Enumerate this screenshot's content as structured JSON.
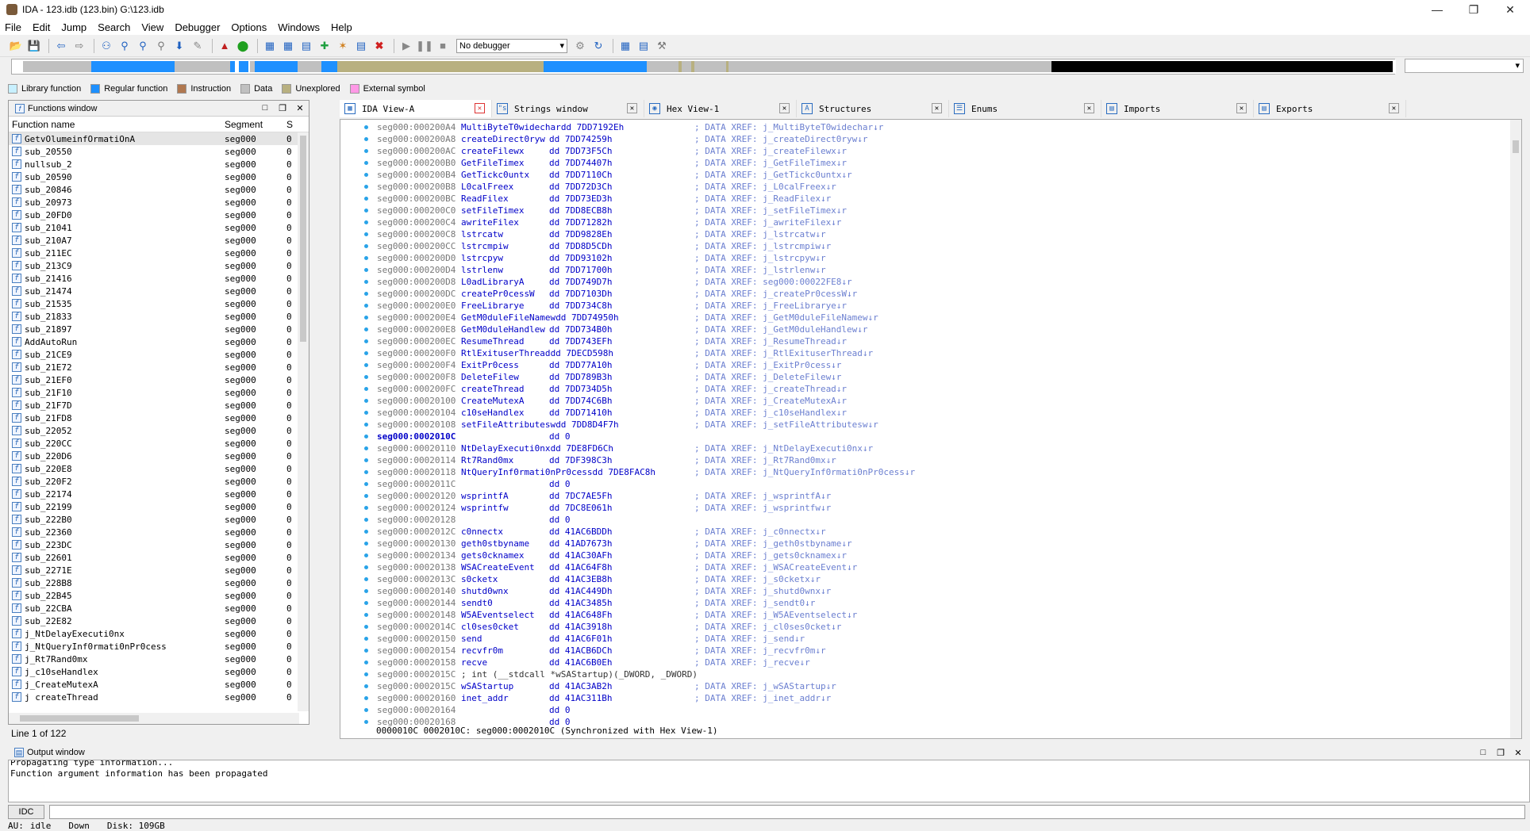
{
  "window": {
    "title": "IDA - 123.idb (123.bin) G:\\123.idb"
  },
  "menu": [
    "File",
    "Edit",
    "Jump",
    "Search",
    "View",
    "Debugger",
    "Options",
    "Windows",
    "Help"
  ],
  "toolbar": {
    "debugger_select": "No debugger"
  },
  "legend": [
    {
      "label": "Library function",
      "color": "#c8f0ff"
    },
    {
      "label": "Regular function",
      "color": "#1e90ff"
    },
    {
      "label": "Instruction",
      "color": "#b07850"
    },
    {
      "label": "Data",
      "color": "#c0c0c0"
    },
    {
      "label": "Unexplored",
      "color": "#b8b080"
    },
    {
      "label": "External symbol",
      "color": "#ff99e6"
    }
  ],
  "functions_window": {
    "title": "Functions window",
    "columns": [
      "Function name",
      "Segment",
      "S"
    ],
    "rows": [
      {
        "name": "GetvOlumeinfOrmatiOnA",
        "seg": "seg000",
        "s": "0"
      },
      {
        "name": "sub_20550",
        "seg": "seg000",
        "s": "0"
      },
      {
        "name": "nullsub_2",
        "seg": "seg000",
        "s": "0"
      },
      {
        "name": "sub_20590",
        "seg": "seg000",
        "s": "0"
      },
      {
        "name": "sub_20846",
        "seg": "seg000",
        "s": "0"
      },
      {
        "name": "sub_20973",
        "seg": "seg000",
        "s": "0"
      },
      {
        "name": "sub_20FD0",
        "seg": "seg000",
        "s": "0"
      },
      {
        "name": "sub_21041",
        "seg": "seg000",
        "s": "0"
      },
      {
        "name": "sub_210A7",
        "seg": "seg000",
        "s": "0"
      },
      {
        "name": "sub_211EC",
        "seg": "seg000",
        "s": "0"
      },
      {
        "name": "sub_213C9",
        "seg": "seg000",
        "s": "0"
      },
      {
        "name": "sub_21416",
        "seg": "seg000",
        "s": "0"
      },
      {
        "name": "sub_21474",
        "seg": "seg000",
        "s": "0"
      },
      {
        "name": "sub_21535",
        "seg": "seg000",
        "s": "0"
      },
      {
        "name": "sub_21833",
        "seg": "seg000",
        "s": "0"
      },
      {
        "name": "sub_21897",
        "seg": "seg000",
        "s": "0"
      },
      {
        "name": "AddAutoRun",
        "seg": "seg000",
        "s": "0"
      },
      {
        "name": "sub_21CE9",
        "seg": "seg000",
        "s": "0"
      },
      {
        "name": "sub_21E72",
        "seg": "seg000",
        "s": "0"
      },
      {
        "name": "sub_21EF0",
        "seg": "seg000",
        "s": "0"
      },
      {
        "name": "sub_21F10",
        "seg": "seg000",
        "s": "0"
      },
      {
        "name": "sub_21F7D",
        "seg": "seg000",
        "s": "0"
      },
      {
        "name": "sub_21FD8",
        "seg": "seg000",
        "s": "0"
      },
      {
        "name": "sub_22052",
        "seg": "seg000",
        "s": "0"
      },
      {
        "name": "sub_220CC",
        "seg": "seg000",
        "s": "0"
      },
      {
        "name": "sub_220D6",
        "seg": "seg000",
        "s": "0"
      },
      {
        "name": "sub_220E8",
        "seg": "seg000",
        "s": "0"
      },
      {
        "name": "sub_220F2",
        "seg": "seg000",
        "s": "0"
      },
      {
        "name": "sub_22174",
        "seg": "seg000",
        "s": "0"
      },
      {
        "name": "sub_22199",
        "seg": "seg000",
        "s": "0"
      },
      {
        "name": "sub_222B0",
        "seg": "seg000",
        "s": "0"
      },
      {
        "name": "sub_22360",
        "seg": "seg000",
        "s": "0"
      },
      {
        "name": "sub_223DC",
        "seg": "seg000",
        "s": "0"
      },
      {
        "name": "sub_22601",
        "seg": "seg000",
        "s": "0"
      },
      {
        "name": "sub_2271E",
        "seg": "seg000",
        "s": "0"
      },
      {
        "name": "sub_228B8",
        "seg": "seg000",
        "s": "0"
      },
      {
        "name": "sub_22B45",
        "seg": "seg000",
        "s": "0"
      },
      {
        "name": "sub_22CBA",
        "seg": "seg000",
        "s": "0"
      },
      {
        "name": "sub_22E82",
        "seg": "seg000",
        "s": "0"
      },
      {
        "name": "j_NtDelayExecuti0nx",
        "seg": "seg000",
        "s": "0"
      },
      {
        "name": "j_NtQueryInf0rmati0nPr0cess",
        "seg": "seg000",
        "s": "0"
      },
      {
        "name": "j_Rt7Rand0mx",
        "seg": "seg000",
        "s": "0"
      },
      {
        "name": "j_c10seHandlex",
        "seg": "seg000",
        "s": "0"
      },
      {
        "name": "j_CreateMutexA",
        "seg": "seg000",
        "s": "0"
      },
      {
        "name": "j_createThread",
        "seg": "seg000",
        "s": "0"
      }
    ],
    "status": "Line 1 of 122"
  },
  "tabs": [
    {
      "label": "IDA View-A",
      "icon": "graph-icon"
    },
    {
      "label": "Strings window",
      "icon": "strings-icon"
    },
    {
      "label": "Hex View-1",
      "icon": "hex-icon"
    },
    {
      "label": "Structures",
      "icon": "struct-icon"
    },
    {
      "label": "Enums",
      "icon": "enum-icon"
    },
    {
      "label": "Imports",
      "icon": "imports-icon"
    },
    {
      "label": "Exports",
      "icon": "exports-icon"
    }
  ],
  "ida_view": {
    "lines": [
      {
        "addr": "seg000:000200A4",
        "name": "MultiByteT0widechar",
        "op": "dd 7DD7192Eh",
        "cm": "; DATA XREF: j_MultiByteT0widechar↓r"
      },
      {
        "addr": "seg000:000200A8",
        "name": "createDirect0ryw",
        "op": "dd 7DD74259h",
        "cm": "; DATA XREF: j_createDirect0ryw↓r"
      },
      {
        "addr": "seg000:000200AC",
        "name": "createFilewx",
        "op": "dd 7DD73F5Ch",
        "cm": "; DATA XREF: j_createFilewx↓r"
      },
      {
        "addr": "seg000:000200B0",
        "name": "GetFileTimex",
        "op": "dd 7DD74407h",
        "cm": "; DATA XREF: j_GetFileTimex↓r"
      },
      {
        "addr": "seg000:000200B4",
        "name": "GetTickc0untx",
        "op": "dd 7DD7110Ch",
        "cm": "; DATA XREF: j_GetTickc0untx↓r"
      },
      {
        "addr": "seg000:000200B8",
        "name": "L0calFreex",
        "op": "dd 7DD72D3Ch",
        "cm": "; DATA XREF: j_L0calFreex↓r"
      },
      {
        "addr": "seg000:000200BC",
        "name": "ReadFilex",
        "op": "dd 7DD73ED3h",
        "cm": "; DATA XREF: j_ReadFilex↓r"
      },
      {
        "addr": "seg000:000200C0",
        "name": "setFileTimex",
        "op": "dd 7DD8ECB8h",
        "cm": "; DATA XREF: j_setFileTimex↓r"
      },
      {
        "addr": "seg000:000200C4",
        "name": "awriteFilex",
        "op": "dd 7DD71282h",
        "cm": "; DATA XREF: j_awriteFilex↓r"
      },
      {
        "addr": "seg000:000200C8",
        "name": "lstrcatw",
        "op": "dd 7DD9828Eh",
        "cm": "; DATA XREF: j_lstrcatw↓r"
      },
      {
        "addr": "seg000:000200CC",
        "name": "lstrcmpiw",
        "op": "dd 7DD8D5CDh",
        "cm": "; DATA XREF: j_lstrcmpiw↓r"
      },
      {
        "addr": "seg000:000200D0",
        "name": "lstrcpyw",
        "op": "dd 7DD93102h",
        "cm": "; DATA XREF: j_lstrcpyw↓r"
      },
      {
        "addr": "seg000:000200D4",
        "name": "lstrlenw",
        "op": "dd 7DD71700h",
        "cm": "; DATA XREF: j_lstrlenw↓r"
      },
      {
        "addr": "seg000:000200D8",
        "name": "L0adLibraryA",
        "op": "dd 7DD749D7h",
        "cm": "; DATA XREF: seg000:00022FE8↓r"
      },
      {
        "addr": "seg000:000200DC",
        "name": "createPr0cessW",
        "op": "dd 7DD7103Dh",
        "cm": "; DATA XREF: j_createPr0cessW↓r"
      },
      {
        "addr": "seg000:000200E0",
        "name": "FreeLibrarye",
        "op": "dd 7DD734C8h",
        "cm": "; DATA XREF: j_FreeLibrarye↓r"
      },
      {
        "addr": "seg000:000200E4",
        "name": "GetM0duleFileNamew",
        "op": "dd 7DD74950h",
        "cm": "; DATA XREF: j_GetM0duleFileNamew↓r"
      },
      {
        "addr": "seg000:000200E8",
        "name": "GetM0duleHandlew",
        "op": "dd 7DD734B0h",
        "cm": "; DATA XREF: j_GetM0duleHandlew↓r"
      },
      {
        "addr": "seg000:000200EC",
        "name": "ResumeThread",
        "op": "dd 7DD743EFh",
        "cm": "; DATA XREF: j_ResumeThread↓r"
      },
      {
        "addr": "seg000:000200F0",
        "name": "RtlExituserThread",
        "op": "dd 7DECD598h",
        "cm": "; DATA XREF: j_RtlExituserThread↓r"
      },
      {
        "addr": "seg000:000200F4",
        "name": "ExitPr0cess",
        "op": "dd 7DD77A10h",
        "cm": "; DATA XREF: j_ExitPr0cess↓r"
      },
      {
        "addr": "seg000:000200F8",
        "name": "DeleteFilew",
        "op": "dd 7DD789B3h",
        "cm": "; DATA XREF: j_DeleteFilew↓r"
      },
      {
        "addr": "seg000:000200FC",
        "name": "createThread",
        "op": "dd 7DD734D5h",
        "cm": "; DATA XREF: j_createThread↓r"
      },
      {
        "addr": "seg000:00020100",
        "name": "CreateMutexA",
        "op": "dd 7DD74C6Bh",
        "cm": "; DATA XREF: j_CreateMutexA↓r"
      },
      {
        "addr": "seg000:00020104",
        "name": "c10seHandlex",
        "op": "dd 7DD71410h",
        "cm": "; DATA XREF: j_c10seHandlex↓r"
      },
      {
        "addr": "seg000:00020108",
        "name": "setFileAttributesw",
        "op": "dd 7DD8D4F7h",
        "cm": "; DATA XREF: j_setFileAttributesw↓r"
      },
      {
        "addr": "seg000:0002010C",
        "name": "",
        "op": "dd 0",
        "cm": "",
        "hl": true
      },
      {
        "addr": "seg000:00020110",
        "name": "NtDelayExecuti0nx",
        "op": "dd 7DE8FD6Ch",
        "cm": "; DATA XREF: j_NtDelayExecuti0nx↓r"
      },
      {
        "addr": "seg000:00020114",
        "name": "Rt7Rand0mx",
        "op": "dd 7DF398C3h",
        "cm": "; DATA XREF: j_Rt7Rand0mx↓r"
      },
      {
        "addr": "seg000:00020118",
        "name": "NtQueryInf0rmati0nPr0cess",
        "op": "dd 7DE8FAC8h",
        "cm": "; DATA XREF: j_NtQueryInf0rmati0nPr0cess↓r"
      },
      {
        "addr": "seg000:0002011C",
        "name": "",
        "op": "dd 0",
        "cm": ""
      },
      {
        "addr": "seg000:00020120",
        "name": "wsprintfA",
        "op": "dd 7DC7AE5Fh",
        "cm": "; DATA XREF: j_wsprintfA↓r"
      },
      {
        "addr": "seg000:00020124",
        "name": "wsprintfw",
        "op": "dd 7DC8E061h",
        "cm": "; DATA XREF: j_wsprintfw↓r"
      },
      {
        "addr": "seg000:00020128",
        "name": "",
        "op": "dd 0",
        "cm": ""
      },
      {
        "addr": "seg000:0002012C",
        "name": "c0nnectx",
        "op": "dd 41AC6BDDh",
        "cm": "; DATA XREF: j_c0nnectx↓r"
      },
      {
        "addr": "seg000:00020130",
        "name": "geth0stbyname",
        "op": "dd 41AD7673h",
        "cm": "; DATA XREF: j_geth0stbyname↓r"
      },
      {
        "addr": "seg000:00020134",
        "name": "gets0cknamex",
        "op": "dd 41AC30AFh",
        "cm": "; DATA XREF: j_gets0cknamex↓r"
      },
      {
        "addr": "seg000:00020138",
        "name": "WSACreateEvent",
        "op": "dd 41AC64F8h",
        "cm": "; DATA XREF: j_WSACreateEvent↓r"
      },
      {
        "addr": "seg000:0002013C",
        "name": "s0cketx",
        "op": "dd 41AC3EB8h",
        "cm": "; DATA XREF: j_s0cketx↓r"
      },
      {
        "addr": "seg000:00020140",
        "name": "shutd0wnx",
        "op": "dd 41AC449Dh",
        "cm": "; DATA XREF: j_shutd0wnx↓r"
      },
      {
        "addr": "seg000:00020144",
        "name": "sendt0",
        "op": "dd 41AC3485h",
        "cm": "; DATA XREF: j_sendt0↓r"
      },
      {
        "addr": "seg000:00020148",
        "name": "W5AEventselect",
        "op": "dd 41AC648Fh",
        "cm": "; DATA XREF: j_W5AEventselect↓r"
      },
      {
        "addr": "seg000:0002014C",
        "name": "cl0ses0cket",
        "op": "dd 41AC3918h",
        "cm": "; DATA XREF: j_cl0ses0cket↓r"
      },
      {
        "addr": "seg000:00020150",
        "name": "send",
        "op": "dd 41AC6F01h",
        "cm": "; DATA XREF: j_send↓r"
      },
      {
        "addr": "seg000:00020154",
        "name": "recvfr0m",
        "op": "dd 41ACB6DCh",
        "cm": "; DATA XREF: j_recvfr0m↓r"
      },
      {
        "addr": "seg000:00020158",
        "name": "recve",
        "op": "dd 41AC6B0Eh",
        "cm": "; DATA XREF: j_recve↓r"
      },
      {
        "addr": "seg000:0002015C",
        "name": "",
        "op": "; int (__stdcall *wSAStartup)(_DWORD, _DWORD)",
        "cm": "",
        "raw": true
      },
      {
        "addr": "seg000:0002015C",
        "name": "wSAStartup",
        "op": "dd 41AC3AB2h",
        "cm": "; DATA XREF: j_wSAStartup↓r"
      },
      {
        "addr": "seg000:00020160",
        "name": "inet_addr",
        "op": "dd 41AC311Bh",
        "cm": "; DATA XREF: j_inet_addr↓r"
      },
      {
        "addr": "seg000:00020164",
        "name": "",
        "op": "dd 0",
        "cm": ""
      },
      {
        "addr": "seg000:00020168",
        "name": "",
        "op": "dd 0",
        "cm": ""
      }
    ],
    "status": "0000010C 0002010C: seg000:0002010C (Synchronized with Hex View-1)"
  },
  "output_window": {
    "title": "Output window",
    "lines": [
      "Propagating type information...",
      "Function argument information has been propagated"
    ],
    "idc_button": "IDC"
  },
  "statusbar": {
    "au_label": "AU:",
    "au_value": "idle",
    "direction": "Down",
    "disk": "Disk: 109GB"
  }
}
